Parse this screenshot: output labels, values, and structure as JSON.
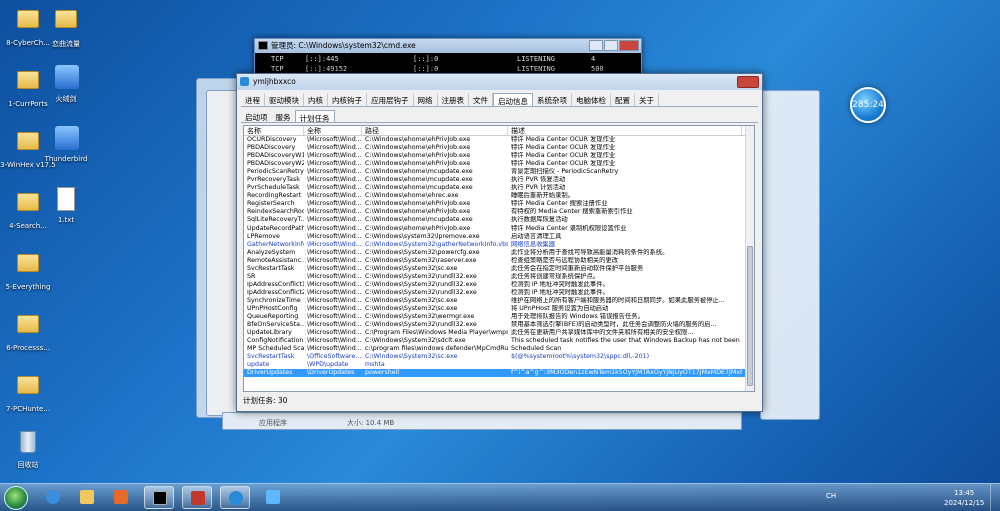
{
  "desktop": {
    "icons": [
      {
        "label": "8-CyberCh...",
        "type": "folder",
        "x": 0,
        "y": 0
      },
      {
        "label": "恋曲流量",
        "type": "folder",
        "x": 1,
        "y": 0
      },
      {
        "label": "1-CurrPorts",
        "type": "folder",
        "x": 0,
        "y": 1
      },
      {
        "label": "火绒剑",
        "type": "shortcut",
        "x": 1,
        "y": 1
      },
      {
        "label": "3-WinHex v17.5",
        "type": "folder",
        "x": 0,
        "y": 2
      },
      {
        "label": "Thunderbird",
        "type": "shortcut",
        "x": 1,
        "y": 2
      },
      {
        "label": "4-Search...",
        "type": "folder",
        "x": 0,
        "y": 3
      },
      {
        "label": "1.txt",
        "type": "doc",
        "x": 1,
        "y": 3
      },
      {
        "label": "5-Everything",
        "type": "folder",
        "x": 0,
        "y": 4
      },
      {
        "label": "6-Processs...",
        "type": "folder",
        "x": 0,
        "y": 5
      },
      {
        "label": "7-PCHunte...",
        "type": "folder",
        "x": 0,
        "y": 6
      },
      {
        "label": "回收站",
        "type": "bin",
        "x": 0,
        "y": 7
      }
    ]
  },
  "cmd": {
    "title": "管理员: C:\\Windows\\system32\\cmd.exe",
    "lines": [
      [
        "TCP",
        "[::]:445",
        "[::]:0",
        "LISTENING",
        "4"
      ],
      [
        "TCP",
        "[::]:49152",
        "[::]:0",
        "LISTENING",
        "500"
      ]
    ]
  },
  "main": {
    "title": "ymljhbxxco",
    "tabs": [
      "进程",
      "驱动模块",
      "内核",
      "内核钩子",
      "应用层钩子",
      "网络",
      "注册表",
      "文件",
      "启动信息",
      "系统杂项",
      "电脑体检",
      "配置",
      "关于"
    ],
    "active_tab": "启动信息",
    "subtabs": [
      "启动项",
      "服务",
      "计划任务"
    ],
    "active_subtab": "计划任务",
    "columns": [
      "名称",
      "全称",
      "路径",
      "描述"
    ],
    "rows": [
      [
        "名称",
        "全称",
        "路径",
        "描述"
      ],
      [
        "OCURDiscovery",
        "\\Microsoft\\Wind...",
        "C:\\Windows\\ehome\\ehPrivJob.exe",
        "特许 Media Center OCUR 发现作业"
      ],
      [
        "PBDADiscovery",
        "\\Microsoft\\Wind...",
        "C:\\Windows\\ehome\\ehPrivJob.exe",
        "特许 Media Center OCUR 发现作业"
      ],
      [
        "PBDADiscoveryW1",
        "\\Microsoft\\Wind...",
        "C:\\Windows\\ehome\\ehPrivJob.exe",
        "特许 Media Center OCUR 发现作业"
      ],
      [
        "PBDADiscoveryW2",
        "\\Microsoft\\Wind...",
        "C:\\Windows\\ehome\\ehPrivJob.exe",
        "特许 Media Center OCUR 发现作业"
      ],
      [
        "PeriodicScanRetry",
        "\\Microsoft\\Wind...",
        "C:\\Windows\\ehome\\mcupdate.exe",
        "背景定期扫描仪 - PeriodicScanRetry"
      ],
      [
        "PvrRecoveryTask",
        "\\Microsoft\\Wind...",
        "C:\\Windows\\ehome\\mcupdate.exe",
        "执行 PVR 恢复活动"
      ],
      [
        "PvrScheduleTask",
        "\\Microsoft\\Wind...",
        "C:\\Windows\\ehome\\mcupdate.exe",
        "执行 PVR 计划活动"
      ],
      [
        "RecordingRestart",
        "\\Microsoft\\Wind...",
        "C:\\Windows\\ehome\\ehrec.exe",
        "睡眠后重新开始录制。"
      ],
      [
        "RegisterSearch",
        "\\Microsoft\\Wind...",
        "C:\\Windows\\ehome\\ehPrivJob.exe",
        "特许 Media Center 搜索注册作业"
      ],
      [
        "ReindexSearchRoot",
        "\\Microsoft\\Wind...",
        "C:\\Windows\\ehome\\ehPrivJob.exe",
        "有特权的 Media Center 搜索重新索引作业"
      ],
      [
        "SqlLiteRecoveryT...",
        "\\Microsoft\\Wind...",
        "C:\\Windows\\ehome\\mcupdate.exe",
        "执行数据库恢复活动"
      ],
      [
        "UpdateRecordPath",
        "\\Microsoft\\Wind...",
        "C:\\Windows\\ehome\\ehPrivJob.exe",
        "特许 Media Center 录制机权限设置作业"
      ],
      [
        "LPRemove",
        "\\Microsoft\\Wind...",
        "C:\\Windows\\system32\\lpremove.exe",
        "启动语言清理工具"
      ],
      [
        "GatherNetworkInfo",
        "\\Microsoft\\Wind...",
        "C:\\Windows\\System32\\gatherNetworkInfo.vbs",
        "网络信息收集器"
      ],
      [
        "AnalyzeSystem",
        "\\Microsoft\\Wind...",
        "C:\\Windows\\System32\\powercfg.exe",
        "此作业将分析用于查找可导致高能量消耗的条件的系统。"
      ],
      [
        "RemoteAssistanc...",
        "\\Microsoft\\Wind...",
        "C:\\Windows\\System32\\raserver.exe",
        "检查组策略是否与远程协助相关的更改"
      ],
      [
        "SvcRestartTask",
        "\\Microsoft\\Wind...",
        "C:\\Windows\\System32\\sc.exe",
        "此任务会在指定时间重新启动软件保护平台服务"
      ],
      [
        "SR",
        "\\Microsoft\\Wind...",
        "C:\\Windows\\System32\\rundll32.exe",
        "此任务将创建常规系统保护点。"
      ],
      [
        "IpAddressConflict1",
        "\\Microsoft\\Wind...",
        "C:\\Windows\\System32\\rundll32.exe",
        "检测到 IP 地址冲突时触发此事件。"
      ],
      [
        "IpAddressConflict2",
        "\\Microsoft\\Wind...",
        "C:\\Windows\\System32\\rundll32.exe",
        "检测到 IP 地址冲突时触发此事件。"
      ],
      [
        "SynchronizeTime",
        "\\Microsoft\\Wind...",
        "C:\\Windows\\System32\\sc.exe",
        "维护在网络上的所有客户端和服务器的时间和日期同步。如果此服务被停止..."
      ],
      [
        "UPnPHostConfig",
        "\\Microsoft\\Wind...",
        "C:\\Windows\\System32\\sc.exe",
        "将 UPnPHost 服务设置为自动启动"
      ],
      [
        "QueueReporting",
        "\\Microsoft\\Wind...",
        "C:\\Windows\\System32\\wermgr.exe",
        "用于处理排队报告的 Windows 错误报告任务。"
      ],
      [
        "BfeOnServiceSta...",
        "\\Microsoft\\Wind...",
        "C:\\Windows\\System32\\rundll32.exe",
        "禁用基本筛选引擎(BFE)的启动类型时，此任务会调整防火墙的服务的启..."
      ],
      [
        "UpdateLibrary",
        "\\Microsoft\\Wind...",
        "C:\\Program Files\\Windows Media Player\\wmpns...",
        "此任务在更新用户共享媒体库中的文件夹和所有相关的安全权限..."
      ],
      [
        "ConfigNotification",
        "\\Microsoft\\Wind...",
        "C:\\Windows\\System32\\sdclt.exe",
        "This scheduled task notifies the user that Windows Backup has not been configured"
      ],
      [
        "MP Scheduled Scan",
        "\\Microsoft\\Wind...",
        "c:\\program files\\windows defender\\MpCmdRun....",
        "Scheduled Scan"
      ],
      [
        "SvcRestartTask",
        "\\OfficeSoftware...",
        "C:\\Windows\\System32\\sc.exe",
        "$(@%systemroot%\\system32\\sppc.dll,-201)"
      ],
      [
        "update",
        "\\WPD\\update",
        "mshta",
        ""
      ],
      [
        "DriverUpdates",
        "\\DriverUpdates",
        "powershell",
        "f^i^a^g^:3M3ODen1zEwNTem1k5OyYjMTAxOyYjNjUyOT17JMxMDE7JMxMDg7JM..."
      ]
    ],
    "blue_rows": [
      14,
      28,
      29
    ],
    "selected_row": 29,
    "status": "计划任务: 30"
  },
  "behind": {
    "footer_left": "应用程序",
    "footer_size": "大小: 10.4 MB"
  },
  "gadget": {
    "time": "285:24"
  },
  "taskbar": {
    "tray_lang": "CH",
    "time": "13:45",
    "date": "2024/12/15"
  },
  "colors": {
    "desktop": "#1d73c8",
    "selection": "#3399ff",
    "link": "#1a3fc6"
  }
}
